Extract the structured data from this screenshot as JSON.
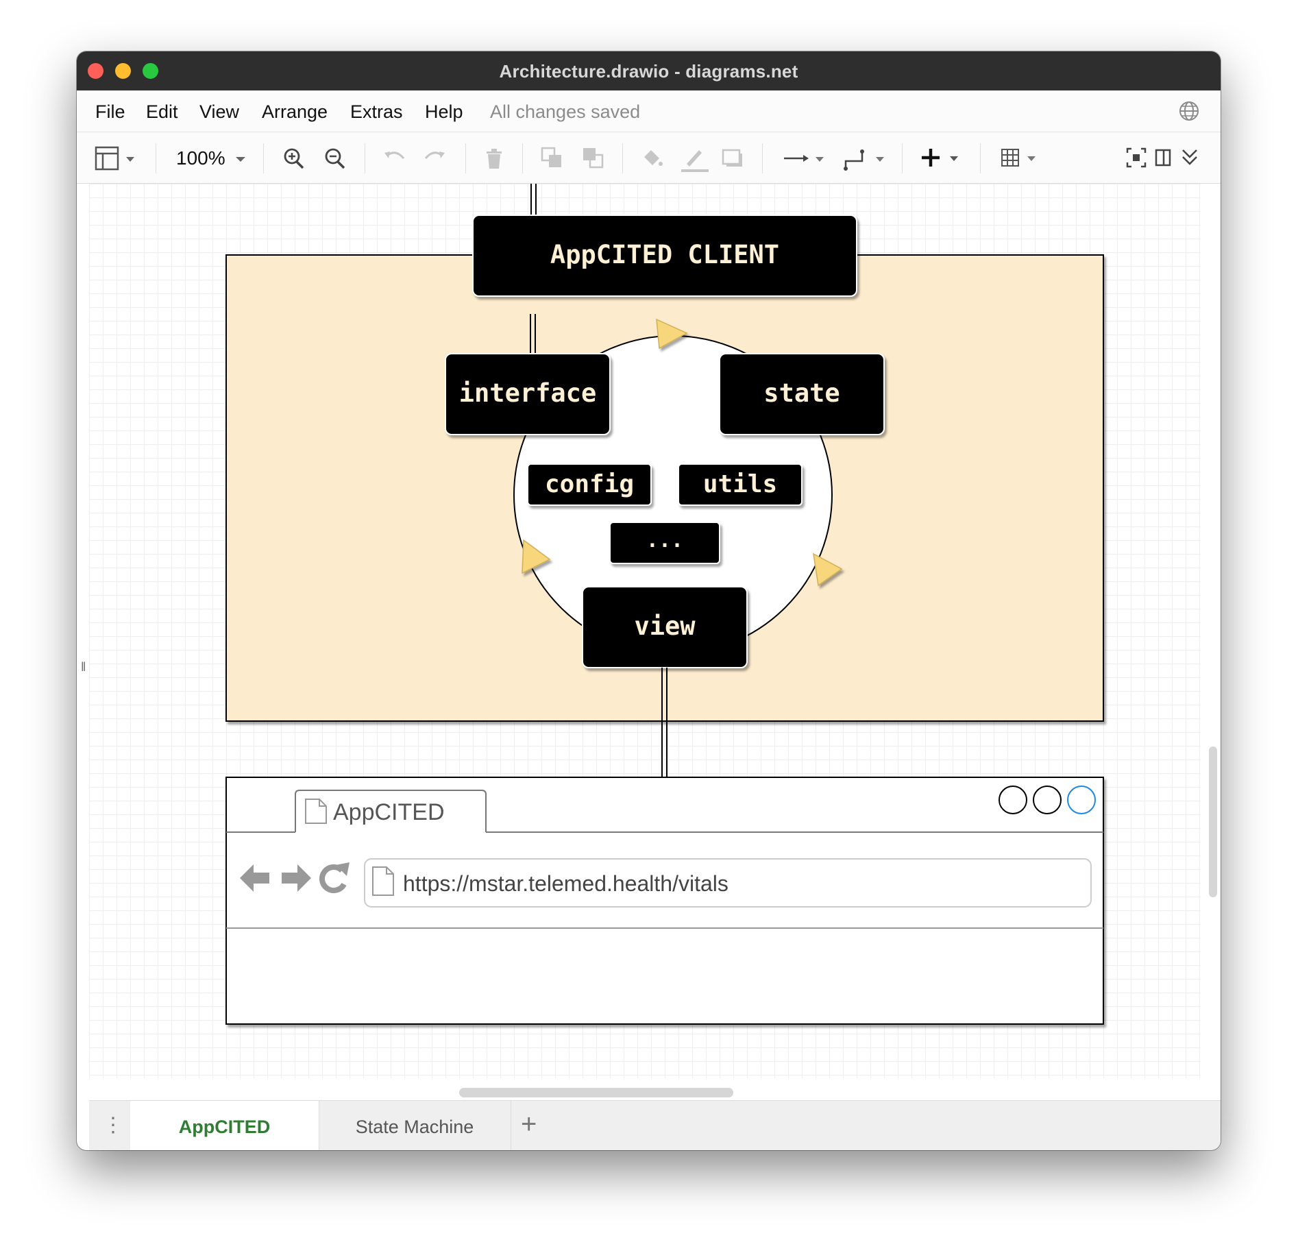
{
  "window": {
    "title": "Architecture.drawio - diagrams.net"
  },
  "menubar": {
    "items": [
      "File",
      "Edit",
      "View",
      "Arrange",
      "Extras",
      "Help"
    ],
    "status": "All changes saved"
  },
  "toolbar": {
    "zoom": "100%"
  },
  "diagram": {
    "client_title": "AppCITED CLIENT",
    "modules": {
      "interface": "interface",
      "state": "state",
      "config": "config",
      "utils": "utils",
      "more": "...",
      "view": "view"
    },
    "browser": {
      "tab_title": "AppCITED",
      "url": "https://mstar.telemed.health/vitals"
    },
    "colors": {
      "container_fill": "#fcebcd",
      "box_fill": "#000000",
      "box_text": "#fdf0d5",
      "arrow_fill": "#f7d67c",
      "link_blue": "#1e88e5"
    }
  },
  "pages": {
    "tabs": [
      "AppCITED",
      "State Machine"
    ],
    "active": "AppCITED"
  }
}
